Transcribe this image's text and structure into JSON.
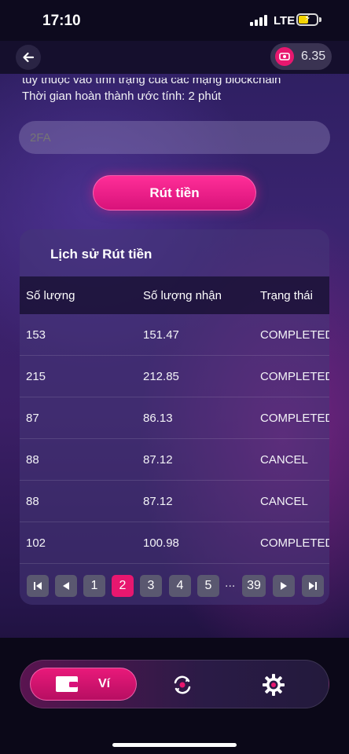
{
  "status_bar": {
    "time": "17:10",
    "network": "LTE"
  },
  "header": {
    "balance": "6.35",
    "back_icon": "arrow-left-icon",
    "coin_icon": "coin-icon"
  },
  "info": {
    "line1": "tùy thuộc vào tình trạng của các mạng blockchain",
    "line2": "Thời gian hoàn thành ước tính: 2 phút"
  },
  "form": {
    "twofa_placeholder": "2FA",
    "submit_label": "Rút tiền"
  },
  "history": {
    "title": "Lịch sử Rút tiền",
    "columns": [
      "Số lượng",
      "Số lượng nhận",
      "Trạng thái"
    ],
    "rows": [
      [
        "153",
        "151.47",
        "COMPLETED"
      ],
      [
        "215",
        "212.85",
        "COMPLETED"
      ],
      [
        "87",
        "86.13",
        "COMPLETED"
      ],
      [
        "88",
        "87.12",
        "CANCEL"
      ],
      [
        "88",
        "87.12",
        "CANCEL"
      ],
      [
        "102",
        "100.98",
        "COMPLETED"
      ]
    ],
    "pagination": {
      "pages": [
        "1",
        "2",
        "3",
        "4",
        "5"
      ],
      "current": "2",
      "ellipsis": "...",
      "last": "39"
    }
  },
  "nav": {
    "wallet_label": "Ví"
  },
  "colors": {
    "accent": "#e8176f",
    "background": "#2a1d5c"
  }
}
